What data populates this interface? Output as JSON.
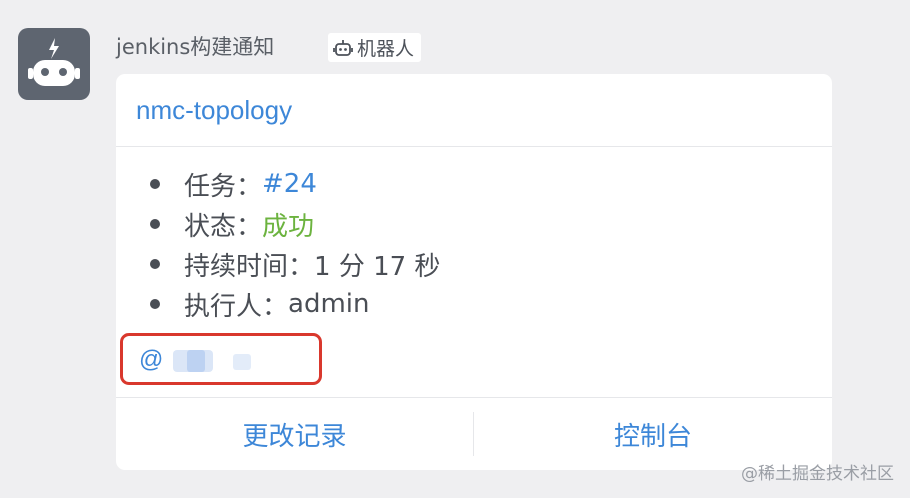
{
  "message": {
    "sender_name": "jenkins构建通知",
    "bot_tag": "机器人",
    "avatar_icon": "robot-icon"
  },
  "card": {
    "title": "nmc-topology",
    "details": [
      {
        "label": "任务：",
        "value": "#24"
      },
      {
        "label": "状态：",
        "value": "成功"
      },
      {
        "label": "持续时间：",
        "value": "1 分 17 秒"
      },
      {
        "label": "执行人：",
        "value": "admin"
      }
    ],
    "mention": "@",
    "actions": {
      "changes": "更改记录",
      "console": "控制台"
    }
  },
  "watermark": "@稀土掘金技术社区",
  "colors": {
    "link": "#3d87d8",
    "success": "#6cb33f",
    "highlight_border": "#d9382d",
    "avatar_bg": "#5e6570"
  }
}
